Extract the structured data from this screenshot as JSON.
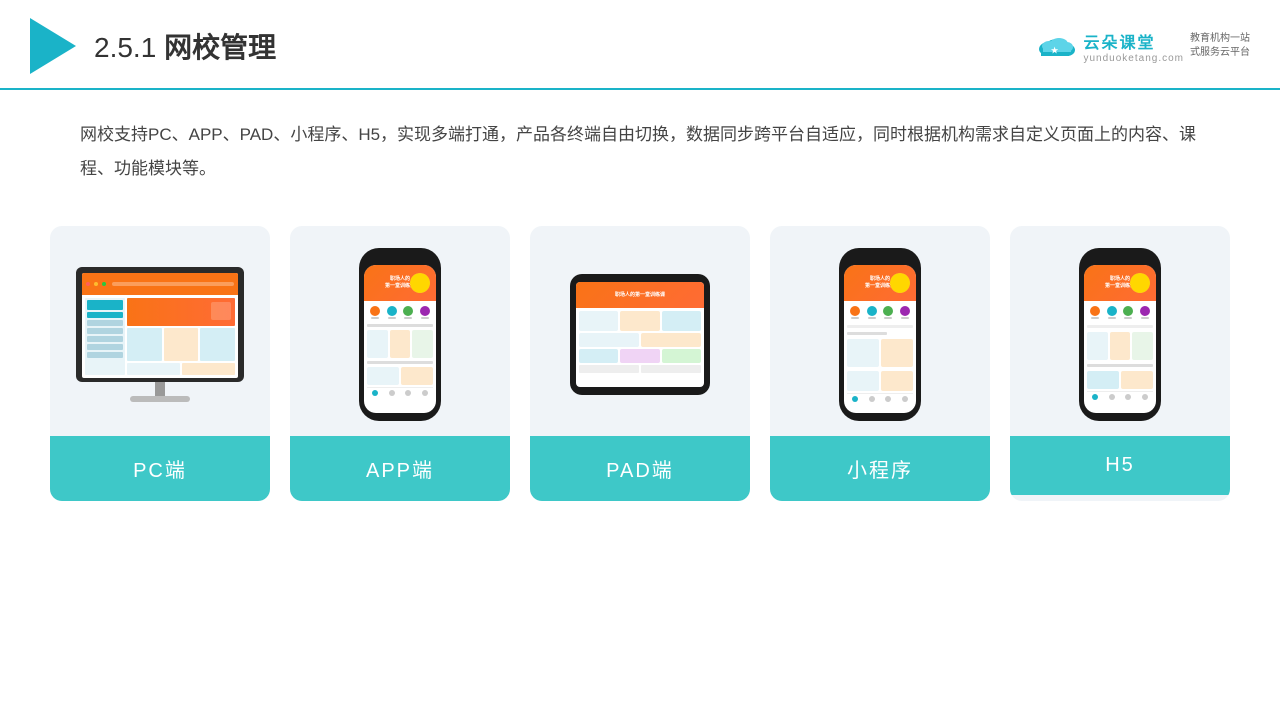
{
  "header": {
    "title_prefix": "2.5.1",
    "title_main": "网校管理"
  },
  "brand": {
    "name": "云朵课堂",
    "url": "yunduoketang.com",
    "tagline_line1": "教育机构一站",
    "tagline_line2": "式服务云平台"
  },
  "description": "网校支持PC、APP、PAD、小程序、H5，实现多端打通，产品各终端自由切换，数据同步跨平台自适应，同时根据机构需求自定义页面上的内容、课程、功能模块等。",
  "cards": [
    {
      "id": "pc",
      "label": "PC端"
    },
    {
      "id": "app",
      "label": "APP端"
    },
    {
      "id": "pad",
      "label": "PAD端"
    },
    {
      "id": "miniprogram",
      "label": "小程序"
    },
    {
      "id": "h5",
      "label": "H5"
    }
  ]
}
